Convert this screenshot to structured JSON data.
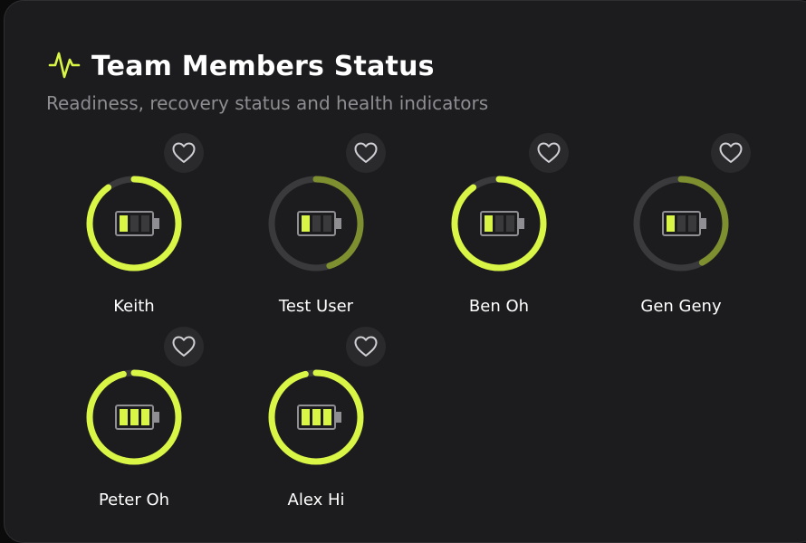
{
  "header": {
    "icon": "activity-pulse-icon",
    "title": "Team Members Status",
    "subtitle": "Readiness, recovery status and health indicators"
  },
  "colors": {
    "accent": "#d9f545",
    "accent_dim": "#7e8f2f",
    "track": "#3a3a3c",
    "background": "#1c1c1e"
  },
  "members": [
    {
      "name": "Keith",
      "ring_progress": 0.9,
      "ring_color": "#d9f545",
      "battery_level": 1,
      "favorite_icon": "heart-outline-icon"
    },
    {
      "name": "Test User",
      "ring_progress": 0.45,
      "ring_color": "#7e8f2f",
      "battery_level": 1,
      "favorite_icon": "heart-outline-icon"
    },
    {
      "name": "Ben Oh",
      "ring_progress": 0.9,
      "ring_color": "#d9f545",
      "battery_level": 1,
      "favorite_icon": "heart-outline-icon"
    },
    {
      "name": "Gen Geny",
      "ring_progress": 0.42,
      "ring_color": "#7e8f2f",
      "battery_level": 1,
      "favorite_icon": "heart-outline-icon"
    },
    {
      "name": "Peter Oh",
      "ring_progress": 0.96,
      "ring_color": "#d9f545",
      "battery_level": 3,
      "favorite_icon": "heart-outline-icon"
    },
    {
      "name": "Alex Hi",
      "ring_progress": 0.96,
      "ring_color": "#d9f545",
      "battery_level": 3,
      "favorite_icon": "heart-outline-icon"
    }
  ]
}
